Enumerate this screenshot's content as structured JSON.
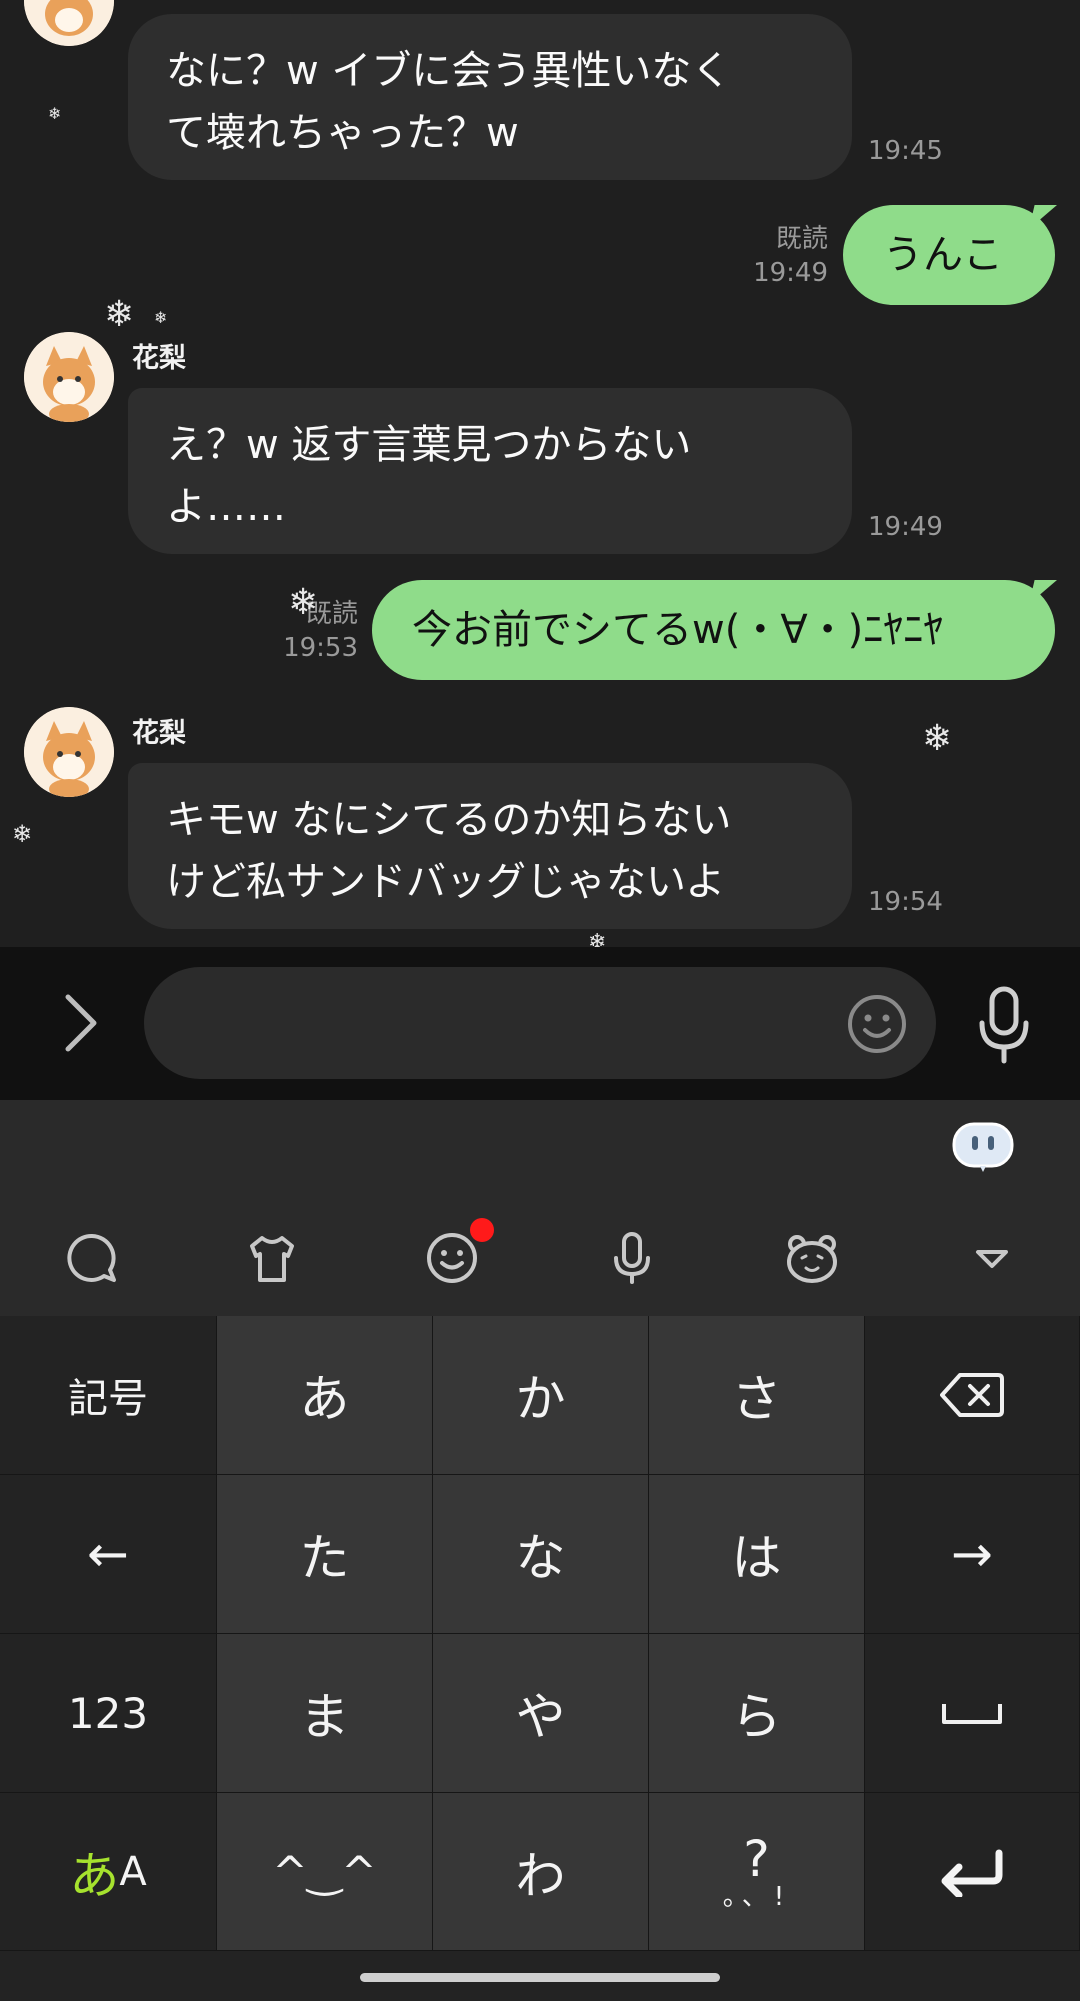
{
  "chat": {
    "messages": [
      {
        "dir": "in",
        "sender": "",
        "text": "なに？w イブに会う異性いなくて壊れちゃった？w",
        "line1": "なに？w イブに会う異性いなく",
        "line2": "て壊れちゃった？w",
        "time": "19:45"
      },
      {
        "dir": "out",
        "text": "うんこ",
        "read": "既読",
        "time": "19:49"
      },
      {
        "dir": "in",
        "sender": "花梨",
        "line1": "え？w 返す言葉見つからない",
        "line2": "よ……",
        "time": "19:49"
      },
      {
        "dir": "out",
        "text": "今お前でシてるw(・∀・)ﾆﾔﾆﾔ",
        "read": "既読",
        "time": "19:53"
      },
      {
        "dir": "in",
        "sender": "花梨",
        "line1": "キモw なにシてるのか知らない",
        "line2": "けど私サンドバッグじゃないよ",
        "time": "19:54"
      }
    ]
  },
  "input": {
    "placeholder": "",
    "value": ""
  },
  "icons": {
    "expand": "chevron-right-icon",
    "emoji": "smiley-icon",
    "mic": "microphone-icon",
    "tools": [
      "chat-bubble-icon",
      "tshirt-icon",
      "emoji-icon",
      "microphone-icon",
      "bear-face-icon",
      "collapse-triangle-icon"
    ]
  },
  "keyboard": {
    "rows": [
      [
        "記号",
        "あ",
        "か",
        "さ",
        "⌫"
      ],
      [
        "←",
        "た",
        "な",
        "は",
        "→"
      ],
      [
        "123",
        "ま",
        "や",
        "ら",
        "␣"
      ],
      [
        "あA",
        "^_^",
        "わ",
        "､｡?!",
        "↵"
      ]
    ],
    "mode_hira": "あ",
    "mode_alpha": "A",
    "punct_main": "?",
    "punct_sub": "。、!",
    "kaomoji": "^‿^"
  },
  "colors": {
    "bubble_out": "#8fdc8a",
    "bubble_in": "#2e2e2e",
    "badge": "#ff1a1a",
    "mode_accent": "#a6e22e"
  }
}
